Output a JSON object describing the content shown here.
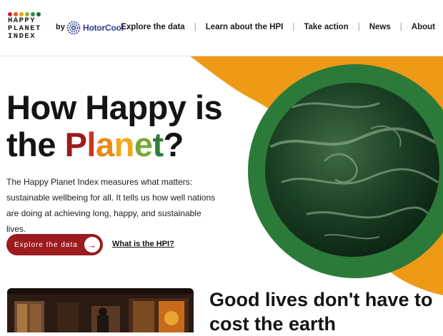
{
  "brand": {
    "logo_lines": [
      "HAPPY",
      "PLANET",
      "INDEX"
    ],
    "logo_dot_colors": [
      "#c1272d",
      "#e8581c",
      "#f2a20f",
      "#8cb63c",
      "#2e8b4a",
      "#1d6b3a"
    ],
    "by_label": "by",
    "partner_label": "HotorCool",
    "partner_icon": "hotorcool-swirl-icon",
    "partner_color": "#2a3e8f"
  },
  "nav": {
    "items": [
      "Explore the data",
      "Learn about the HPI",
      "Take action",
      "News",
      "About"
    ],
    "separator": "|"
  },
  "hero": {
    "title_line1": "How Happy is",
    "title_the": "the ",
    "title_planet_letters": [
      {
        "char": "P",
        "color": "#9b1b1e"
      },
      {
        "char": "l",
        "color": "#c8361f"
      },
      {
        "char": "a",
        "color": "#e98a15"
      },
      {
        "char": "n",
        "color": "#f0a818"
      },
      {
        "char": "e",
        "color": "#7aa838"
      },
      {
        "char": "t",
        "color": "#2e7d3e"
      }
    ],
    "title_qmark": "?",
    "description": "The Happy Planet Index measures what matters: sustainable wellbeing for all. It tells us how well nations are doing at achieving long, happy, and sustainable lives.",
    "primary_button": "Explore the data",
    "primary_button_icon": "arrow-right-icon",
    "secondary_link": "What is the HPI?"
  },
  "section": {
    "title_line1": "Good lives don't have to",
    "title_line2": "cost the earth"
  },
  "colors": {
    "accent_red": "#9b1b1e",
    "accent_orange": "#ee9a17",
    "accent_green": "#2b7a3a",
    "globe_dark": "#0d2a15"
  }
}
